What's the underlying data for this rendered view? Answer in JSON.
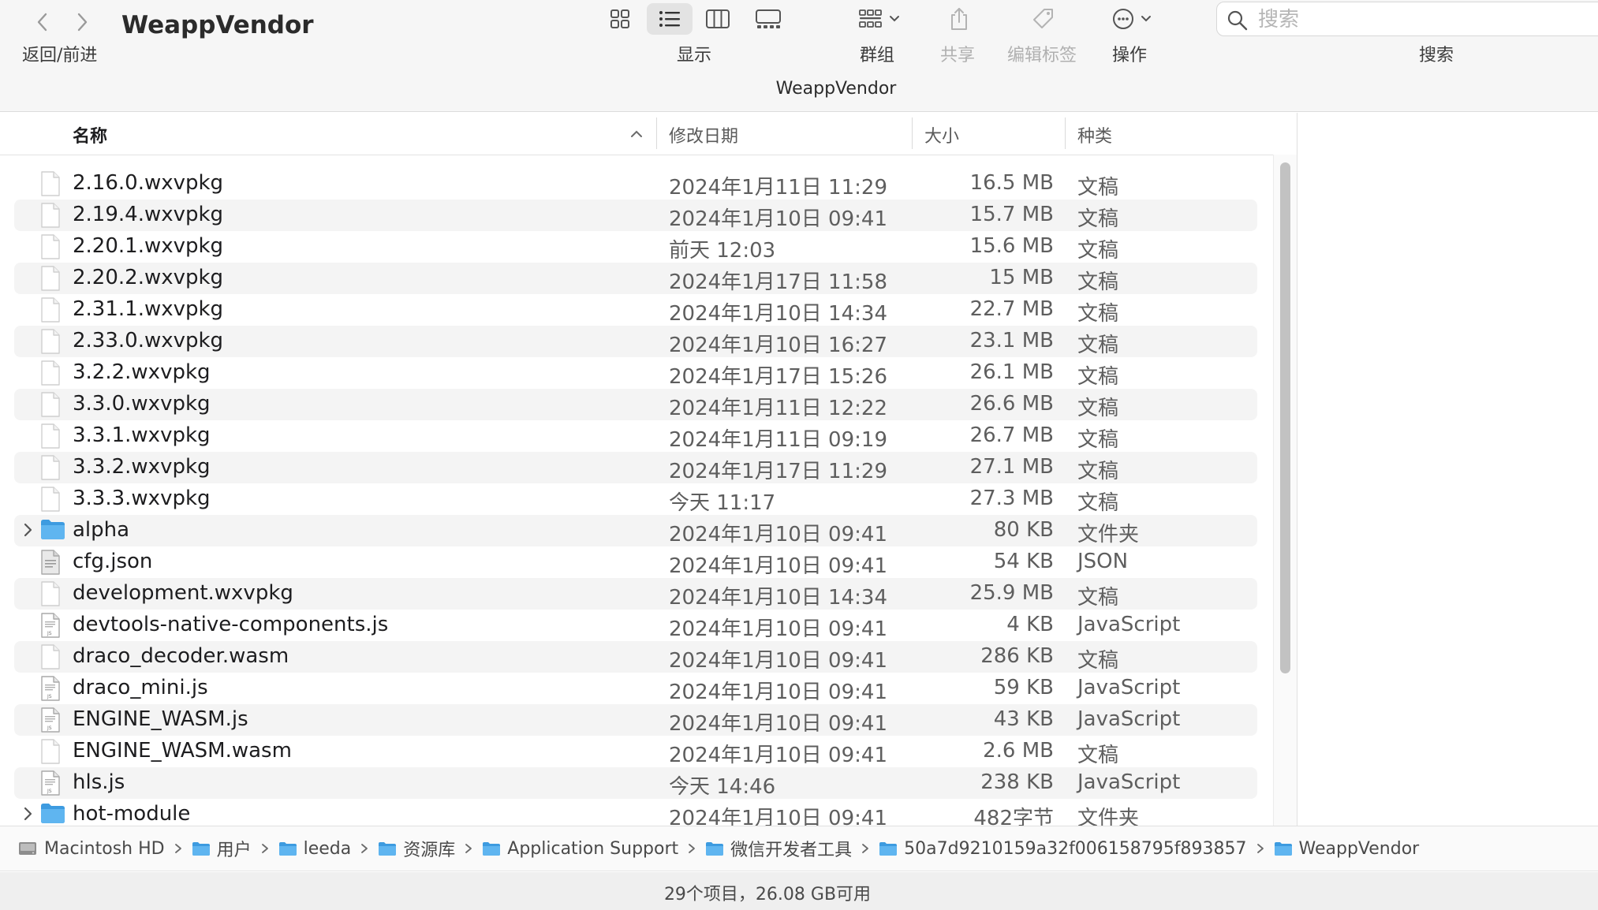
{
  "window": {
    "title": "WeappVendor",
    "path_title": "WeappVendor"
  },
  "toolbar": {
    "nav_label": "返回/前进",
    "view_label": "显示",
    "group_label": "群组",
    "share_label": "共享",
    "tags_label": "编辑标签",
    "action_label": "操作",
    "search_label": "搜索",
    "search_placeholder": "搜索",
    "icons": [
      "chevron-left-icon",
      "chevron-right-icon",
      "icon-view-icon",
      "list-view-icon",
      "column-view-icon",
      "gallery-view-icon",
      "group-icon",
      "share-icon",
      "tag-icon",
      "ellipsis-circle-icon",
      "magnifier-icon"
    ]
  },
  "columns": {
    "name": "名称",
    "date": "修改日期",
    "size": "大小",
    "kind": "种类"
  },
  "files": [
    {
      "name": "2.16.0.wxvpkg",
      "date": "2024年1月11日 11:29",
      "size": "16.5 MB",
      "kind": "文稿",
      "type": "doc"
    },
    {
      "name": "2.19.4.wxvpkg",
      "date": "2024年1月10日 09:41",
      "size": "15.7 MB",
      "kind": "文稿",
      "type": "doc"
    },
    {
      "name": "2.20.1.wxvpkg",
      "date": "前天 12:03",
      "size": "15.6 MB",
      "kind": "文稿",
      "type": "doc"
    },
    {
      "name": "2.20.2.wxvpkg",
      "date": "2024年1月17日 11:58",
      "size": "15 MB",
      "kind": "文稿",
      "type": "doc"
    },
    {
      "name": "2.31.1.wxvpkg",
      "date": "2024年1月10日 14:34",
      "size": "22.7 MB",
      "kind": "文稿",
      "type": "doc"
    },
    {
      "name": "2.33.0.wxvpkg",
      "date": "2024年1月10日 16:27",
      "size": "23.1 MB",
      "kind": "文稿",
      "type": "doc"
    },
    {
      "name": "3.2.2.wxvpkg",
      "date": "2024年1月17日 15:26",
      "size": "26.1 MB",
      "kind": "文稿",
      "type": "doc"
    },
    {
      "name": "3.3.0.wxvpkg",
      "date": "2024年1月11日 12:22",
      "size": "26.6 MB",
      "kind": "文稿",
      "type": "doc"
    },
    {
      "name": "3.3.1.wxvpkg",
      "date": "2024年1月11日 09:19",
      "size": "26.7 MB",
      "kind": "文稿",
      "type": "doc"
    },
    {
      "name": "3.3.2.wxvpkg",
      "date": "2024年1月17日 11:29",
      "size": "27.1 MB",
      "kind": "文稿",
      "type": "doc"
    },
    {
      "name": "3.3.3.wxvpkg",
      "date": "今天 11:17",
      "size": "27.3 MB",
      "kind": "文稿",
      "type": "doc"
    },
    {
      "name": "alpha",
      "date": "2024年1月10日 09:41",
      "size": "80 KB",
      "kind": "文件夹",
      "type": "folder"
    },
    {
      "name": "cfg.json",
      "date": "2024年1月10日 09:41",
      "size": "54 KB",
      "kind": "JSON",
      "type": "json"
    },
    {
      "name": "development.wxvpkg",
      "date": "2024年1月10日 14:34",
      "size": "25.9 MB",
      "kind": "文稿",
      "type": "doc"
    },
    {
      "name": "devtools-native-components.js",
      "date": "2024年1月10日 09:41",
      "size": "4 KB",
      "kind": "JavaScript",
      "type": "js"
    },
    {
      "name": "draco_decoder.wasm",
      "date": "2024年1月10日 09:41",
      "size": "286 KB",
      "kind": "文稿",
      "type": "doc"
    },
    {
      "name": "draco_mini.js",
      "date": "2024年1月10日 09:41",
      "size": "59 KB",
      "kind": "JavaScript",
      "type": "js"
    },
    {
      "name": "ENGINE_WASM.js",
      "date": "2024年1月10日 09:41",
      "size": "43 KB",
      "kind": "JavaScript",
      "type": "js"
    },
    {
      "name": "ENGINE_WASM.wasm",
      "date": "2024年1月10日 09:41",
      "size": "2.6 MB",
      "kind": "文稿",
      "type": "doc"
    },
    {
      "name": "hls.js",
      "date": "今天 14:46",
      "size": "238 KB",
      "kind": "JavaScript",
      "type": "js"
    },
    {
      "name": "hot-module",
      "date": "2024年1月10日 09:41",
      "size": "482字节",
      "kind": "文件夹",
      "type": "folder"
    }
  ],
  "breadcrumbs": [
    {
      "label": "Macintosh HD",
      "icon": "disk-icon"
    },
    {
      "label": "用户",
      "icon": "folder-icon"
    },
    {
      "label": "leeda",
      "icon": "folder-icon"
    },
    {
      "label": "资源库",
      "icon": "folder-icon"
    },
    {
      "label": "Application Support",
      "icon": "folder-icon"
    },
    {
      "label": "微信开发者工具",
      "icon": "folder-icon"
    },
    {
      "label": "50a7d9210159a32f006158795f893857",
      "icon": "folder-icon"
    },
    {
      "label": "WeappVendor",
      "icon": "folder-icon"
    }
  ],
  "status": {
    "text": "29个项目，26.08 GB可用"
  },
  "colors": {
    "folder_blue": "#4aa8e8",
    "row_stripe": "#f4f4f4",
    "toolbar_bg": "#f6f6f6"
  }
}
